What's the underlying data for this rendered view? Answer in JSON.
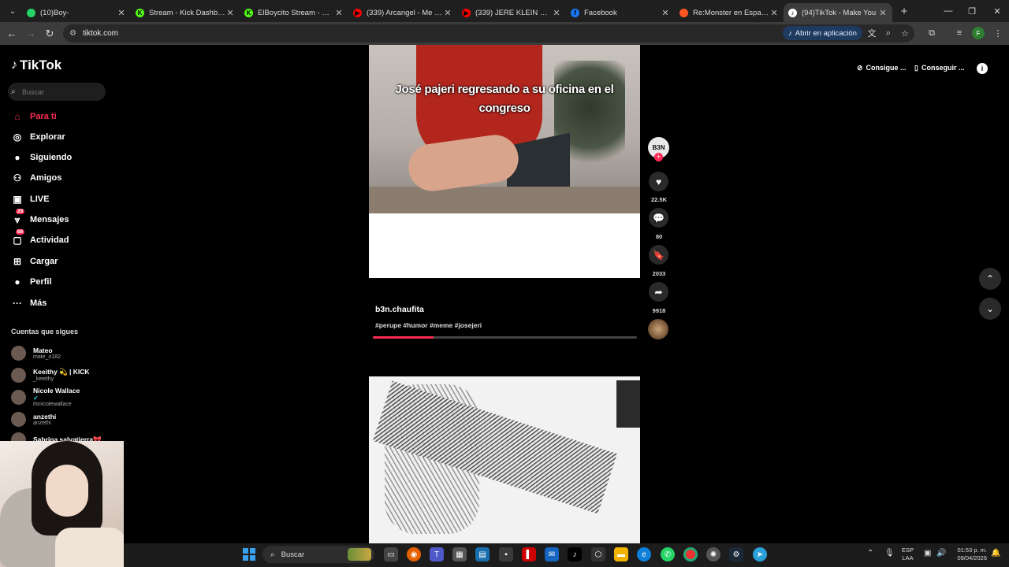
{
  "browser": {
    "tabs": [
      {
        "label": "(10)Boy-",
        "favicon_color": "#25d366",
        "favicon_text": ""
      },
      {
        "label": "Stream - Kick Dashboard",
        "favicon_color": "#53fc18",
        "favicon_text": "K"
      },
      {
        "label": "ElBoycito Stream - Watch",
        "favicon_color": "#53fc18",
        "favicon_text": "K"
      },
      {
        "label": "(339) Arcangel - Me Prefie",
        "favicon_color": "#ff0000",
        "favicon_text": "▶"
      },
      {
        "label": "(339) JERE KLEIN X KATTE",
        "favicon_color": "#ff0000",
        "favicon_text": "▶"
      },
      {
        "label": "Facebook",
        "favicon_color": "#1877f2",
        "favicon_text": "f"
      },
      {
        "label": "Re:Monster en Español (S",
        "favicon_color": "#ff5722",
        "favicon_text": ""
      },
      {
        "label": "(94)TikTok - Make You",
        "favicon_color": "#ffffff",
        "favicon_text": "♪",
        "active": true
      }
    ],
    "url": "tiktok.com",
    "open_app_label": "Abrir en aplicación",
    "profile_initial": "F"
  },
  "sidebar": {
    "logo_text": "TikTok",
    "search_placeholder": "Buscar",
    "nav": [
      {
        "label": "Para ti",
        "icon": "home-icon",
        "active": true
      },
      {
        "label": "Explorar",
        "icon": "compass-icon"
      },
      {
        "label": "Siguiendo",
        "icon": "following-avatar-icon"
      },
      {
        "label": "Amigos",
        "icon": "friends-icon"
      },
      {
        "label": "LIVE",
        "icon": "live-icon"
      },
      {
        "label": "Mensajes",
        "icon": "messages-icon",
        "badge": "29"
      },
      {
        "label": "Actividad",
        "icon": "activity-icon",
        "badge": "66"
      },
      {
        "label": "Cargar",
        "icon": "upload-icon"
      },
      {
        "label": "Perfil",
        "icon": "profile-icon"
      },
      {
        "label": "Más",
        "icon": "more-icon"
      }
    ],
    "following_title": "Cuentas que sigues",
    "accounts": [
      {
        "name": "Mateo",
        "handle": "mate_o182"
      },
      {
        "name": "Keeithy 💫 | KICK",
        "handle": "_keeithy"
      },
      {
        "name": "Nicole Wallace",
        "handle": "itsnicolewallace",
        "verified": true
      },
      {
        "name": "anzethi",
        "handle": "anzethi"
      },
      {
        "name": "Sabrina salvatierra🎀",
        "handle": ""
      }
    ]
  },
  "header": {
    "get_coins_label": "Consigue ...",
    "get_app_label": "Conseguir ..."
  },
  "video": {
    "caption": "José pajeri regresando a su oficina en el congreso",
    "author": "b3n.chaufita",
    "hashtags": "#perupe #humor #meme #josejeri",
    "progress": 0.23,
    "avatar_text": "B3N",
    "likes": "22.5K",
    "comments": "80",
    "saves": "2033",
    "shares": "9918"
  },
  "taskbar": {
    "search_label": "Buscar",
    "lang_line1": "ESP",
    "lang_line2": "LAA",
    "time": "01:53 p. m.",
    "date": "09/04/2026"
  }
}
